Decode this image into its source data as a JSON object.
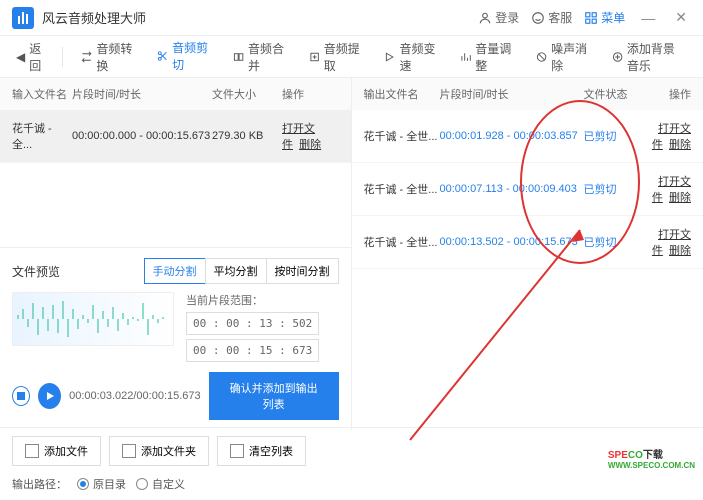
{
  "title": "风云音频处理大师",
  "titlebar": {
    "login": "登录",
    "service": "客服",
    "menu": "菜单"
  },
  "toolbar": {
    "back": "返回",
    "items": [
      "音频转换",
      "音频剪切",
      "音频合并",
      "音频提取",
      "音频变速",
      "音量调整",
      "噪声消除",
      "添加背景音乐"
    ]
  },
  "input_table": {
    "headers": [
      "输入文件名",
      "片段时间/时长",
      "文件大小",
      "操作"
    ],
    "rows": [
      {
        "name": "花千诚 - 全...",
        "time": "00:00:00.000 - 00:00:15.673",
        "size": "279.30 KB",
        "open": "打开文件",
        "del": "删除"
      }
    ]
  },
  "output_table": {
    "headers": [
      "输出文件名",
      "片段时间/时长",
      "文件状态",
      "操作"
    ],
    "rows": [
      {
        "name": "花千诚 - 全世...",
        "time": "00:00:01.928 - 00:00:03.857",
        "status": "已剪切",
        "open": "打开文件",
        "del": "删除"
      },
      {
        "name": "花千诚 - 全世...",
        "time": "00:00:07.113 - 00:00:09.403",
        "status": "已剪切",
        "open": "打开文件",
        "del": "删除"
      },
      {
        "name": "花千诚 - 全世...",
        "time": "00:00:13.502 - 00:00:15.673",
        "status": "已剪切",
        "open": "打开文件",
        "del": "删除"
      }
    ]
  },
  "preview": {
    "title": "文件预览",
    "seg": [
      "手动分割",
      "平均分割",
      "按时间分割"
    ],
    "range_label": "当前片段范围：",
    "start": "00 : 00 : 13 : 502",
    "end": "00 : 00 : 15 : 673",
    "progress": "00:00:03.022/00:00:15.673",
    "confirm": "确认并添加到输出列表"
  },
  "footer": {
    "add_file": "添加文件",
    "add_folder": "添加文件夹",
    "clear": "清空列表",
    "output_label": "输出路径：",
    "radio1": "原目录",
    "radio2": "自定义"
  },
  "watermark": {
    "text": "SPECO下载",
    "sub": "WWW.SPECO.COM.CN"
  }
}
